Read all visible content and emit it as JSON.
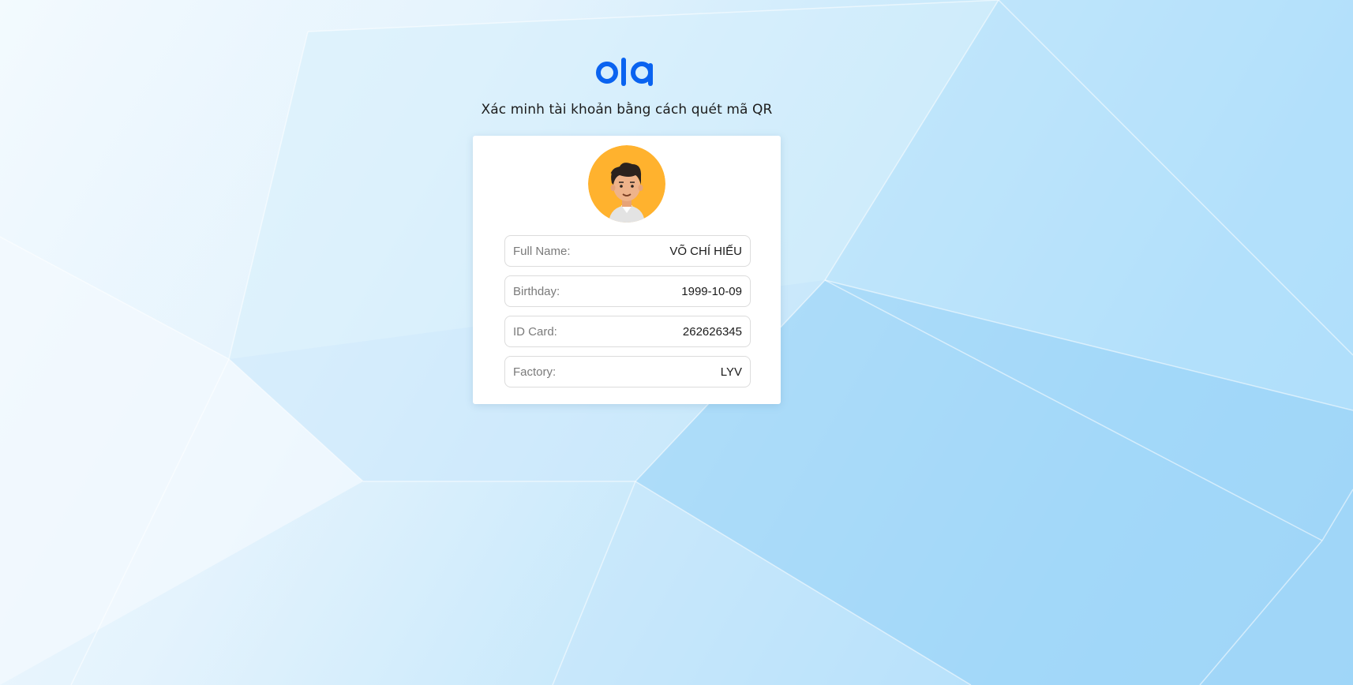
{
  "brand": {
    "logo_text": "ola",
    "logo_color": "#0a63f0"
  },
  "header": {
    "subtitle": "Xác minh tài khoản bằng cách quét mã QR"
  },
  "profile": {
    "avatar_icon": "user-avatar-icon",
    "avatar_bg": "#ffb22e",
    "fields": [
      {
        "label": "Full Name:",
        "value": "VÕ CHÍ HIẾU"
      },
      {
        "label": "Birthday:",
        "value": "1999-10-09"
      },
      {
        "label": "ID Card:",
        "value": "262626345"
      },
      {
        "label": "Factory:",
        "value": "LYV"
      }
    ]
  }
}
